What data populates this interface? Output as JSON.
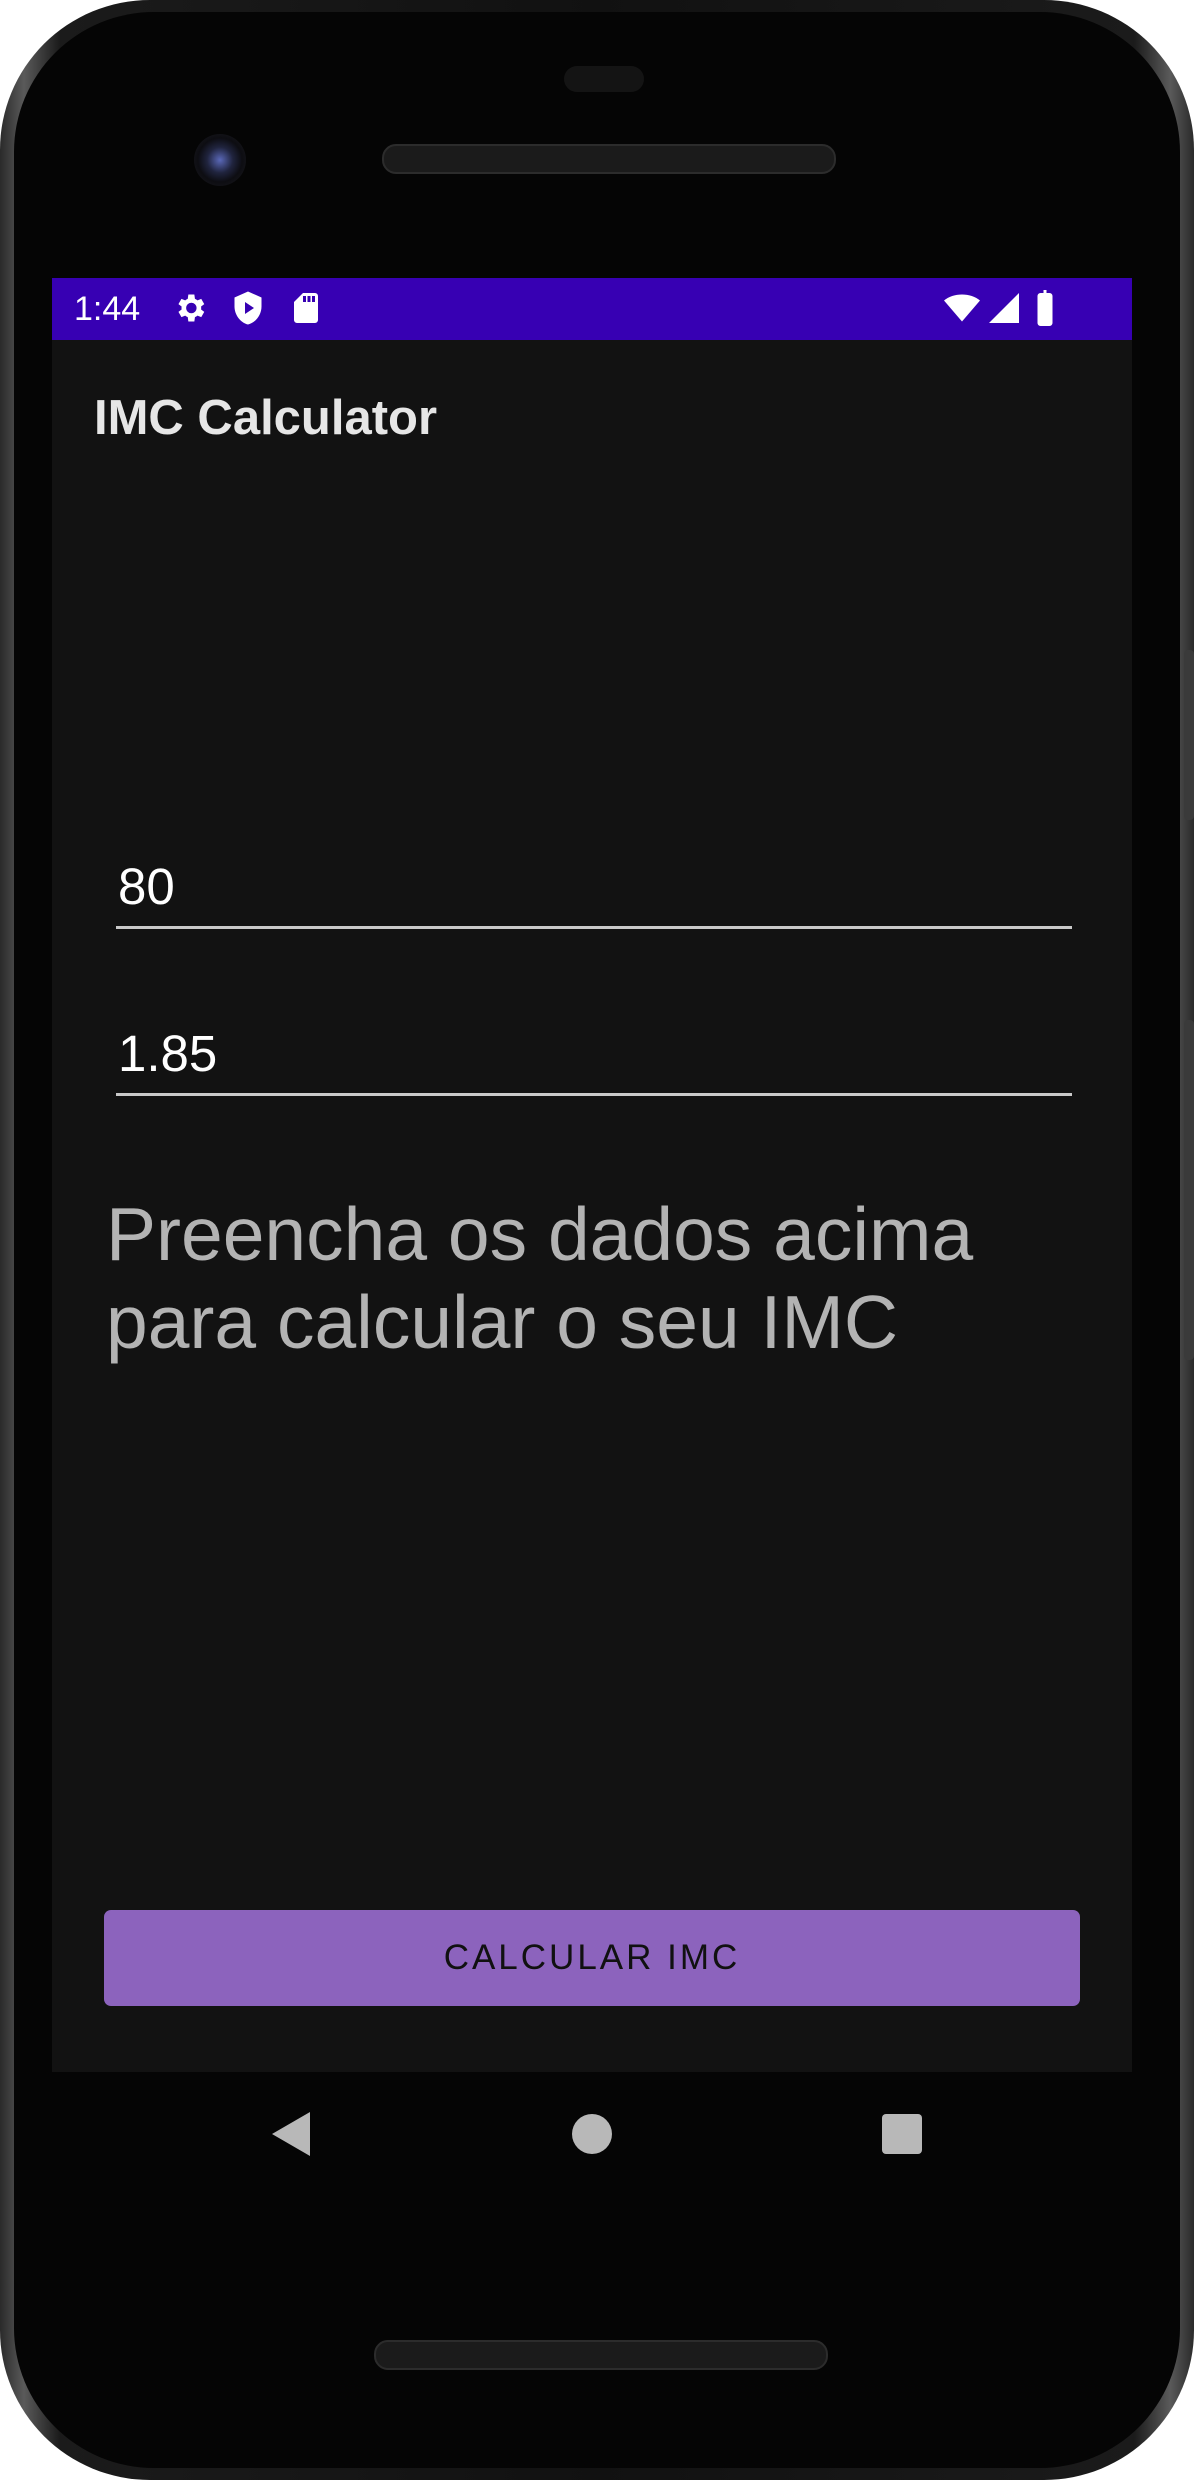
{
  "status_bar": {
    "time": "1:44",
    "left_icons": [
      "gear-icon",
      "shield-play-icon",
      "sd-card-icon"
    ],
    "right_icons": [
      "wifi-icon",
      "cellular-signal-icon",
      "battery-icon"
    ],
    "color": "#3700b3"
  },
  "app": {
    "title": "IMC Calculator"
  },
  "form": {
    "weight_value": "80",
    "height_value": "1.85"
  },
  "result": {
    "text": "Preencha os dados acima\npara calcular  o  seu IMC"
  },
  "button": {
    "label": "CALCULAR IMC",
    "color": "#8c63bd"
  },
  "navigation": {
    "buttons": [
      "back-icon",
      "home-icon",
      "recents-icon"
    ]
  },
  "colors": {
    "background": "#121212"
  }
}
